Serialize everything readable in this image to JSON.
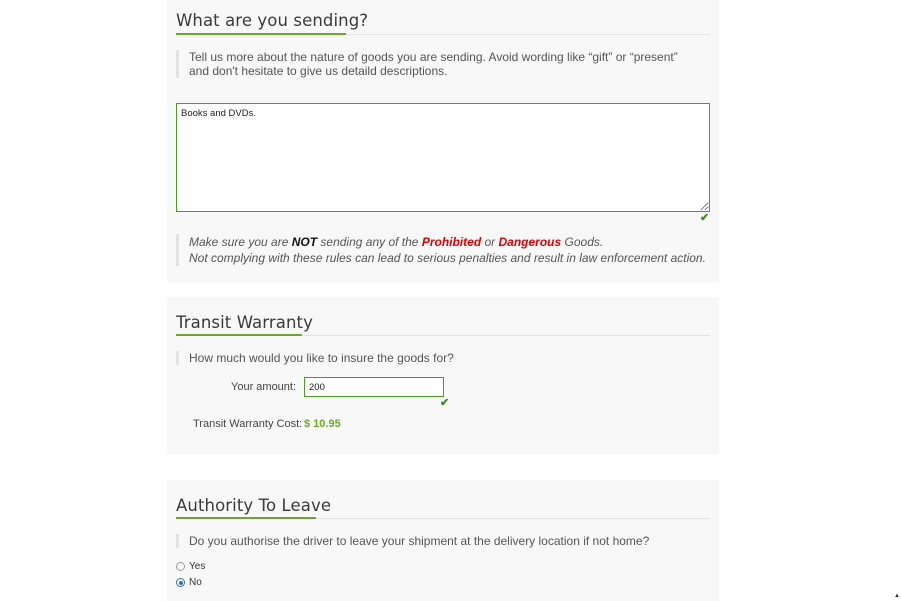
{
  "goods_section": {
    "title": "What are you sending?",
    "intro": "Tell us more about the nature of goods you are sending. Avoid wording like “gift” or “present” and don't hesitate to give us detaild descriptions.",
    "description_value": "Books and DVDs.",
    "warning": {
      "prefix": "Make sure you are ",
      "not": "NOT",
      "middle": " sending any of the ",
      "prohibited": "Prohibited",
      "or": " or ",
      "dangerous": "Dangerous",
      "suffix": " Goods.",
      "line2": "Not complying with these rules can lead to serious penalties and result in law enforcement action."
    }
  },
  "warranty_section": {
    "title": "Transit Warranty",
    "question": "How much would you like to insure the goods for?",
    "amount_label": "Your amount:",
    "amount_value": "200",
    "cost_label": "Transit Warranty Cost:",
    "cost_value": "$ 10.95"
  },
  "authority_section": {
    "title": "Authority To Leave",
    "question": "Do you authorise the driver to leave your shipment at the delivery location if not home?",
    "options": [
      {
        "label": "Yes",
        "selected": false
      },
      {
        "label": "No",
        "selected": true
      }
    ]
  },
  "colors": {
    "accent_green": "#6aaa2b",
    "valid_border": "#4c9a2a",
    "warning_red": "#e00000",
    "radio_selected": "#2b6fc9"
  },
  "icons": [
    "valid-check-icon",
    "valid-check-icon",
    "radio-icon",
    "scroll-indicator-icon"
  ]
}
